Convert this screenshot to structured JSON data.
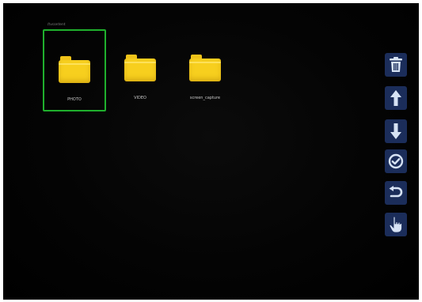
{
  "breadcrumb": "/tvcontent",
  "folders": [
    {
      "label": "PHOTO",
      "selected": true
    },
    {
      "label": "VIDEO",
      "selected": false
    },
    {
      "label": "screen_capture",
      "selected": false
    }
  ],
  "toolbar": {
    "buttons": [
      {
        "icon": "trash-icon"
      },
      {
        "icon": "arrow-up-icon"
      },
      {
        "icon": "arrow-down-icon"
      },
      {
        "icon": "check-circle-icon"
      },
      {
        "icon": "undo-icon"
      },
      {
        "icon": "pointing-hand-icon"
      }
    ]
  },
  "colors": {
    "screen_bg": "#020202",
    "folder_yellow": "#f7cf1e",
    "selection_green": "#1fb02d",
    "toolbar_bg": "#1b2d5a",
    "icon_color": "#d6e2f4"
  }
}
